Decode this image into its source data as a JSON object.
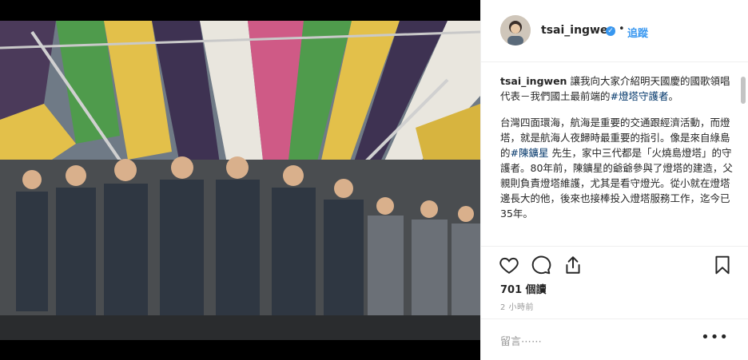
{
  "post": {
    "image_alt": "Honor guard, students and uniformed civilians standing under a striped stage canopy"
  },
  "header": {
    "username": "tsai_ingwen",
    "verified_glyph": "✓",
    "separator": "•",
    "follow_label": "追蹤"
  },
  "caption": {
    "username": "tsai_ingwen",
    "para1_text": "讓我向大家介紹明天國慶的國歌領唱代表－我們國土最前端的",
    "para1_tag": "#燈塔守護者",
    "para1_end": "。",
    "para2_text_a": "台灣四面環海，航海是重要的交通跟經濟活動，而燈塔，就是航海人夜歸時最重要的指引。像是來自綠島的",
    "para2_tag": "#陳鑛星",
    "para2_text_b": " 先生，家中三代都是「火燒島燈塔」的守護者。80年前，陳鑛星的爺爺參與了燈塔的建造，父親則負責燈塔維護，尤其是看守燈光。從小就在燈塔邊長大的他，後來也接棒投入燈塔服務工作，迄今已35年。"
  },
  "actions": {
    "like_icon": "heart-icon",
    "comment_icon": "comment-icon",
    "share_icon": "share-icon",
    "save_icon": "bookmark-icon"
  },
  "stats": {
    "views": "701 個讀",
    "time": "2 小時前"
  },
  "comment": {
    "placeholder": "留言⋯⋯",
    "more_glyph": "•••"
  },
  "colors": {
    "link": "#3897f0",
    "hashtag": "#003569",
    "muted": "#999999",
    "border": "#efefef"
  }
}
